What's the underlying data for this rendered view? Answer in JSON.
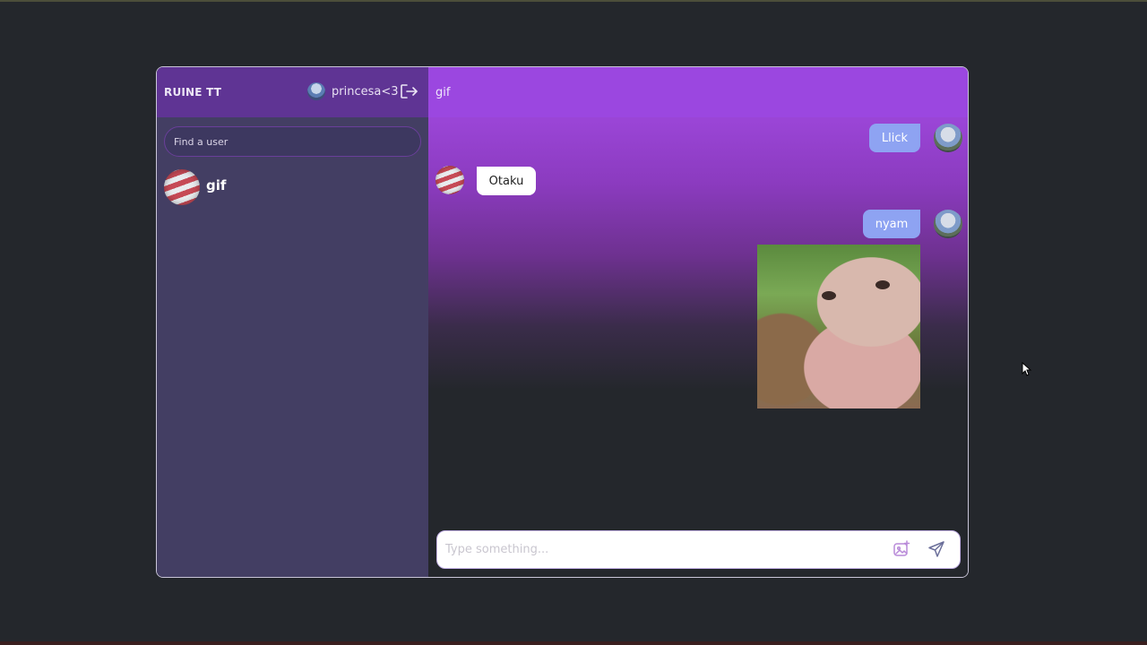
{
  "sidebar": {
    "app_title": "RUINE TT",
    "current_user": {
      "name": "princesa<3",
      "avatar_icon": "anime-avatar"
    },
    "logout_icon": "logout-icon",
    "search": {
      "placeholder": "Find a user",
      "value": ""
    },
    "chats": [
      {
        "name": "gif",
        "avatar_icon": "striped-ball-avatar"
      }
    ]
  },
  "chat": {
    "header": {
      "name": "gif"
    },
    "messages": [
      {
        "sender": "self",
        "text": "Llick"
      },
      {
        "sender": "other",
        "text": "Otaku"
      },
      {
        "sender": "self",
        "text": "nyam"
      },
      {
        "sender": "self",
        "type": "image",
        "alt": "monkey-gif"
      }
    ],
    "composer": {
      "placeholder": "Type something...",
      "value": "",
      "attach_icon": "image-add-icon",
      "send_icon": "send-icon"
    }
  },
  "colors": {
    "sidebar_bg": "#433e63",
    "sidebar_header_bg": "#5f3494",
    "chat_header_bg": "#9b47e0",
    "own_bubble": "#8ea3f2",
    "other_bubble": "#ffffff",
    "page_bg": "#24272c"
  }
}
